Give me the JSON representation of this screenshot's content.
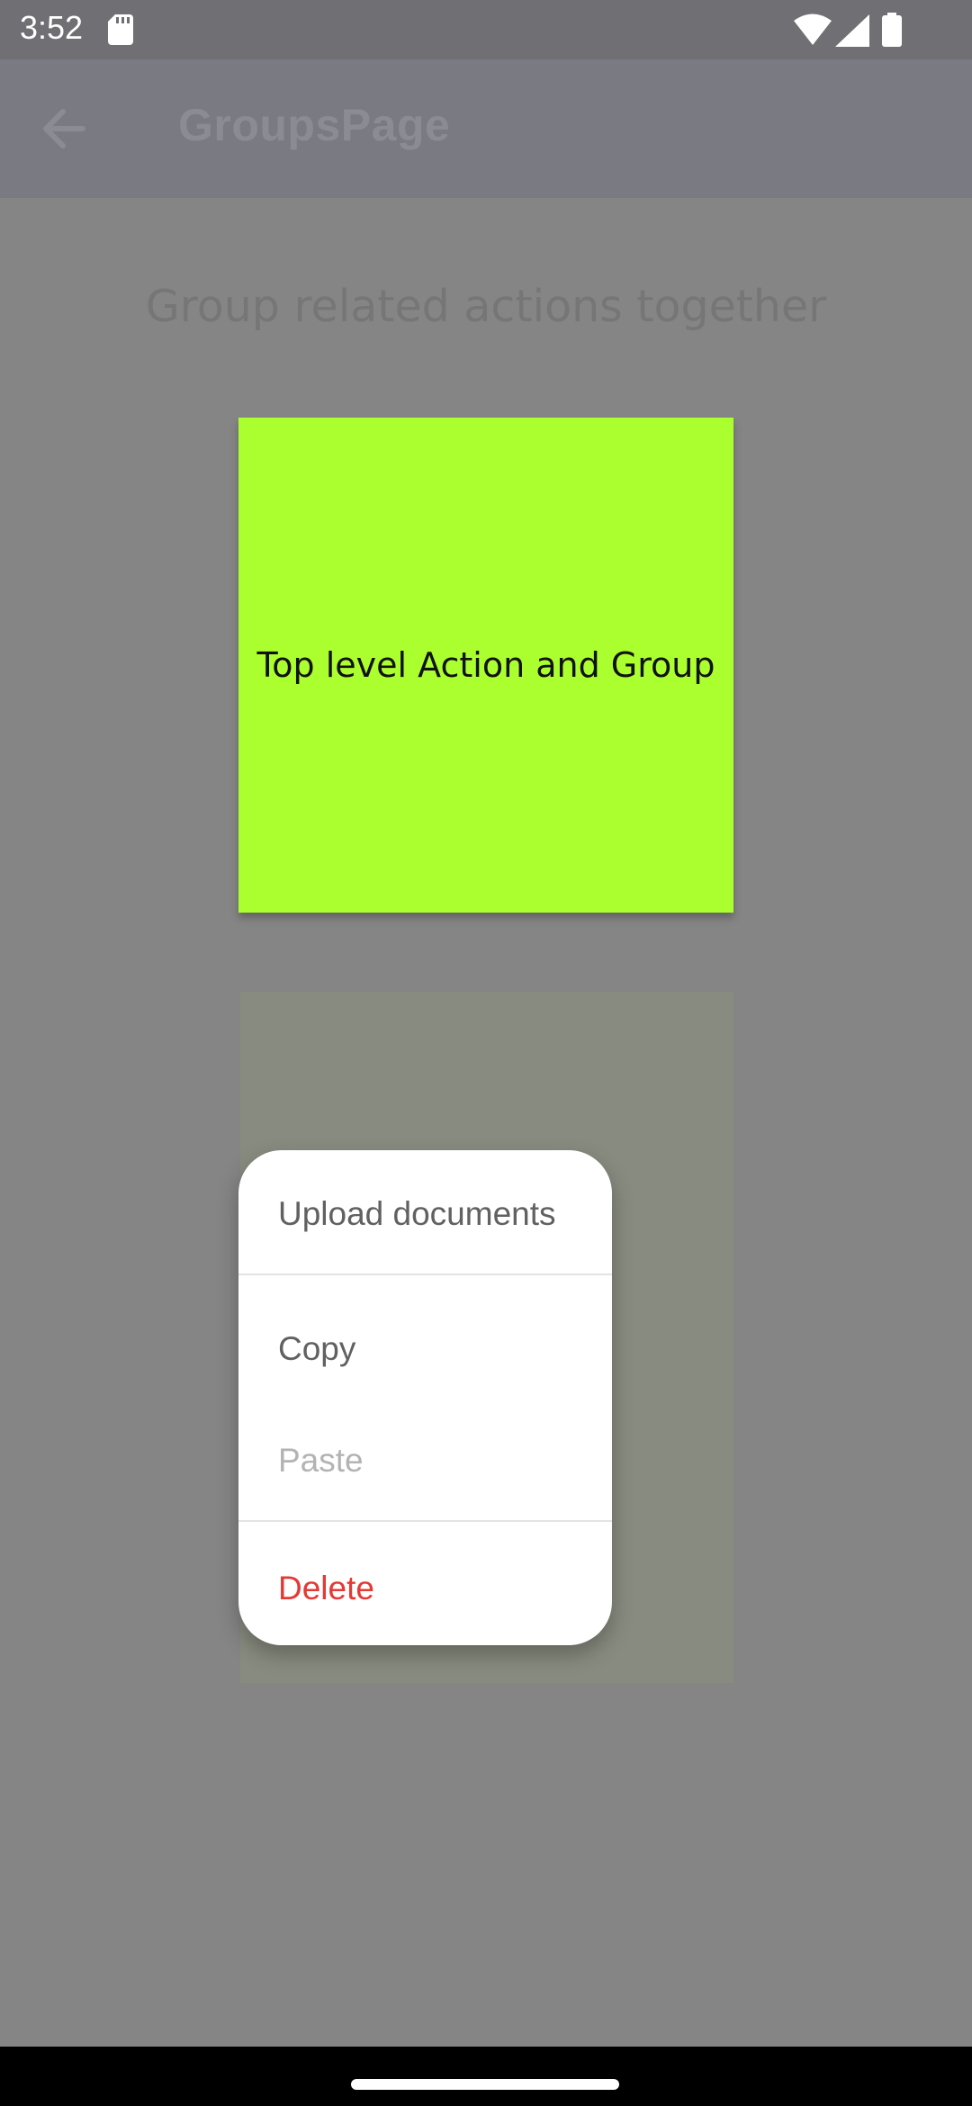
{
  "status_bar": {
    "time": "3:52",
    "icons": [
      "sd-card-icon",
      "wifi-icon",
      "signal-icon",
      "battery-icon"
    ]
  },
  "app_bar": {
    "title": "GroupsPage",
    "back_icon": "arrow-left-icon"
  },
  "main": {
    "heading": "Group related actions together",
    "box_label": "Top level Action and Group",
    "box_color": "#abff2f"
  },
  "context_menu": {
    "items": [
      {
        "label": "Upload documents",
        "enabled": true
      },
      {
        "label": "Copy",
        "enabled": true
      },
      {
        "label": "Paste",
        "enabled": false
      },
      {
        "label": "Delete",
        "destructive": true,
        "color": "#e53935"
      }
    ]
  },
  "colors": {
    "scrim": "#858585",
    "app_bar": "#7a7a83",
    "status_bar": "#6f6f74",
    "destructive": "#e53935"
  }
}
